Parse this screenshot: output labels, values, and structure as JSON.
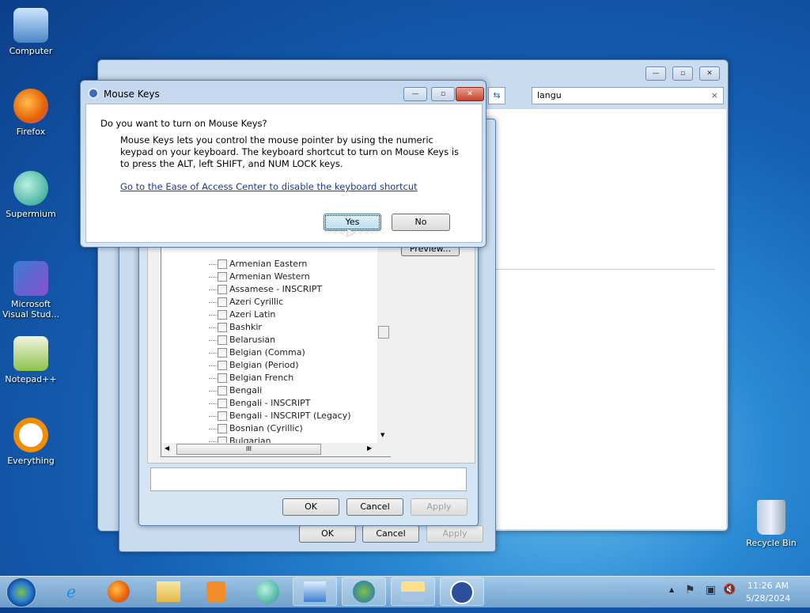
{
  "desktop": {
    "icons": [
      {
        "label": "Computer",
        "color": "#6fa8dc"
      },
      {
        "label": "Firefox",
        "color": "#e66000"
      },
      {
        "label": "Supermium",
        "color": "#2aa198"
      },
      {
        "label": "Microsoft Visual Stud...",
        "color": "#7b4fbf"
      },
      {
        "label": "Notepad++",
        "color": "#8bc34a"
      },
      {
        "label": "Everything",
        "color": "#f28c00"
      }
    ],
    "recycle_bin": "Recycle Bin"
  },
  "back_window": {
    "search_value": "langu",
    "clear": "×"
  },
  "window2": {
    "ok": "OK",
    "cancel": "Cancel",
    "apply": "Apply"
  },
  "window3": {
    "ok": "OK",
    "cancel": "Cancel",
    "apply": "Apply",
    "preview": "Preview...",
    "scroll_grip": "III",
    "items": [
      "Armenian Eastern",
      "Armenian Western",
      "Assamese - INSCRIPT",
      "Azeri Cyrillic",
      "Azeri Latin",
      "Bashkir",
      "Belarusian",
      "Belgian (Comma)",
      "Belgian (Period)",
      "Belgian French",
      "Bengali",
      "Bengali - INSCRIPT",
      "Bengali - INSCRIPT (Legacy)",
      "Bosnian (Cyrillic)",
      "Bulgarian"
    ]
  },
  "dialog": {
    "title": "Mouse Keys",
    "question": "Do you want to turn on Mouse Keys?",
    "body": "Mouse Keys lets you control the mouse pointer by using the numeric keypad on your keyboard.  The keyboard shortcut to turn on Mouse Keys is to press the ALT, left SHIFT, and NUM LOCK keys.",
    "link": "Go to the Ease of Access Center to disable the keyboard shortcut",
    "yes": "Yes",
    "no": "No"
  },
  "taskbar": {
    "time": "11:26 AM",
    "date": "5/28/2024",
    "apps": [
      "internet-explorer",
      "firefox",
      "file-explorer",
      "media-player",
      "supermium",
      "control-panel",
      "region-language",
      "keyboard",
      "ease-of-access"
    ]
  }
}
